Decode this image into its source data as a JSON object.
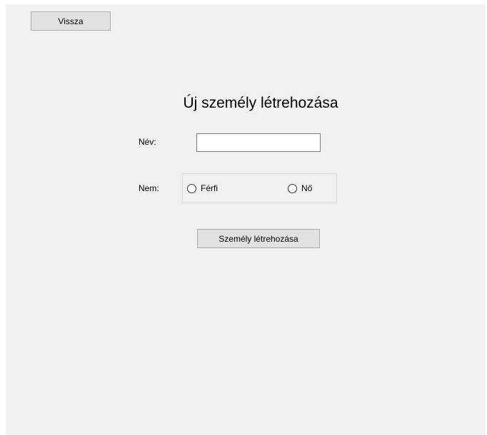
{
  "toolbar": {
    "back_label": "Vissza"
  },
  "form": {
    "title": "Új személy létrehozása",
    "name_label": "Név:",
    "name_value": "",
    "gender_label": "Nem:",
    "gender_options": [
      {
        "label": "Férfi",
        "selected": false
      },
      {
        "label": "Nő",
        "selected": false
      }
    ],
    "submit_label": "Személy létrehozása"
  },
  "colors": {
    "window_background": "#f0f0f0",
    "button_background": "#e1e1e1",
    "button_border": "#adadad"
  }
}
